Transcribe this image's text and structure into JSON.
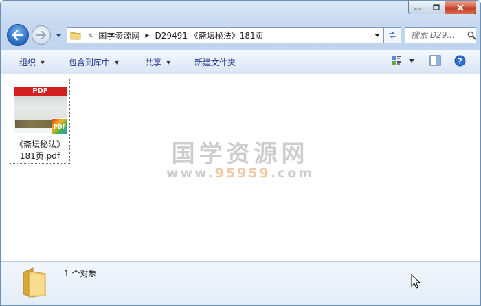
{
  "window": {
    "caption_buttons": [
      "minimize-icon",
      "maximize-icon",
      "close-icon"
    ]
  },
  "nav": {
    "breadcrumb_prefix": "«",
    "crumbs": [
      "国学资源网",
      "D29491 《斋坛秘法》181页"
    ],
    "search_placeholder": "搜索 D29...",
    "icons": [
      "back-arrow-icon",
      "forward-arrow-icon",
      "folder-icon",
      "refresh-icon",
      "search-icon"
    ]
  },
  "toolbar": {
    "organize": "组织",
    "include_library": "包含到库中",
    "share": "共享",
    "new_folder": "新建文件夹",
    "icons": [
      "view-options-icon",
      "preview-pane-icon",
      "help-icon"
    ]
  },
  "content": {
    "file": {
      "thumb_banner": "PDF",
      "badge": "PDF",
      "name_line1": "《斋坛秘法》",
      "name_line2": "181页.pdf"
    },
    "watermark": {
      "title": "国学资源网",
      "url_prefix": "www.",
      "url_number": "95959",
      "url_suffix": ".com"
    }
  },
  "details": {
    "count": "1 个对象"
  },
  "colors": {
    "accent_blue": "#1e3287",
    "pdf_red": "#d21f1f",
    "watermark_gray": "#cdcdcd"
  }
}
